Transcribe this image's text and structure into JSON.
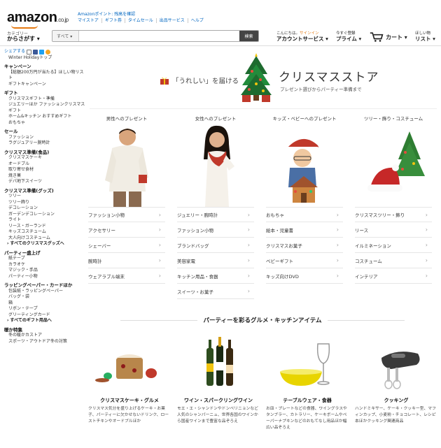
{
  "header": {
    "logo_text": "amazon",
    "logo_suffix": ".co.jp",
    "promo_link": "Amazonポイント: 残高を確認",
    "top_links": [
      "マイストア",
      "ギフト券",
      "タイムセール",
      "出品サービス",
      "ヘルプ"
    ],
    "category_small": "カテゴリー",
    "category_label": "からさがす ▾",
    "search_category": "すべて ▾",
    "search_placeholder": "",
    "search_button": "検索",
    "greeting_pre": "こんにちは。",
    "greeting_signin": "サインイン",
    "account_label": "アカウントサービス ▾",
    "prime_small": "今すぐ登録",
    "prime_label": "プライム ▾",
    "cart_label": "カート ▾",
    "wishlist_small": "ほしい物",
    "wishlist_label": "リスト ▾"
  },
  "sidebar": {
    "share_label": "シェアする",
    "holiday_link": "Winter Holidayトップ",
    "sections": [
      {
        "heading": "キャンペーン",
        "items": [
          "【総額200万円が当たる】ほしい物リスト",
          "ギフトキャンペーン"
        ]
      },
      {
        "heading": "ギフト",
        "items": [
          "クリスマスギフト・準備",
          "ジュエリーほか ファッションクリスマスギフト",
          "ホーム&キッチン おすすめギフト",
          "おもちゃ"
        ]
      },
      {
        "heading": "セール",
        "items": [
          "ファッション",
          "ラグジュアリー腕時計"
        ]
      },
      {
        "heading": "クリスマス準備(食品)",
        "items": [
          "クリスマスケーキ",
          "オードブル",
          "取り寄せ食材",
          "焼き菓",
          "デパ地下スイーツ"
        ]
      },
      {
        "heading": "クリスマス準備(グッズ)",
        "items": [
          "ツリー",
          "ツリー飾り",
          "デコレーション",
          "ガーデンデコレーション",
          "ライト",
          "リース・ガーランド",
          "キッズコスチューム",
          "大人向けコスチューム"
        ],
        "all": "› すべてのクリスマスグッズへ"
      },
      {
        "heading": "パーティー盛上げ",
        "items": [
          "紙テープ",
          "カラオケ",
          "マジック・手品",
          "パーティー小物"
        ]
      },
      {
        "heading": "ラッピングペーパー・カードほか",
        "items": [
          "包装紙・ラッピングペーパー",
          "バッグ・袋",
          "箱",
          "リボン・テープ",
          "グリーティングカード"
        ],
        "all": "› すべてのギフト用品へ"
      },
      {
        "heading": "暖か特集",
        "items": [
          "冬の暖かカストア",
          "スポーツ・アウトドア冬の対策"
        ]
      }
    ]
  },
  "banner": {
    "tagline": "「うれしい」を届ける",
    "title": "クリスマスストア",
    "subtitle": "プレゼント選びからパーティー準備まで"
  },
  "columns": [
    {
      "title": "男性へのプレゼント",
      "items": [
        "ファッション小物",
        "アクセサリー",
        "シェーバー",
        "腕時計",
        "ウェアラブル端末"
      ]
    },
    {
      "title": "女性へのプレゼント",
      "items": [
        "ジュエリー・腕時計",
        "ファッション小物",
        "ブランドバッグ",
        "美容家電",
        "キッチン用品・食器",
        "スイーツ・お菓子"
      ]
    },
    {
      "title": "キッズ・ベビーへのプレゼント",
      "items": [
        "おもちゃ",
        "絵本・児童書",
        "クリスマスお菓子",
        "ベビーギフト",
        "キッズ向けDVD"
      ]
    },
    {
      "title": "ツリー・飾り・コスチューム",
      "items": [
        "クリスマスツリー・飾り",
        "リース",
        "イルミネーション",
        "コスチューム",
        "インテリア"
      ]
    }
  ],
  "gourmet": {
    "title": "パーティーを彩るグルメ・キッチンアイテム",
    "products": [
      {
        "name": "クリスマスケーキ・グルメ",
        "desc": "クリスマス気分を盛り上げるケーキ・お菓子、パーティーに欠かせないドリンク、ローストチキンやオードブルほか"
      },
      {
        "name": "ワイン・スパークリングワイン",
        "desc": "モエ・エ・シャンドンやドンペリニョンなど人気のシャンパーニュ、世界各国のワインから国産ワインまで豊富な品ぞろえ"
      },
      {
        "name": "テーブルウェア・食器",
        "desc": "お皿・プレートなどの食器、ワイングラスやタンブラー、カトラリー、ケーキボームやペーパーナプキンなどのおもてなし用品ほか幅広い品ぞろえ"
      },
      {
        "name": "クッキング",
        "desc": "ハンドミキサー、ケーキ・クッキー型、マフィンカップ、小麦粉・チョコレート、レシピ本ほかクッキング関連商品"
      }
    ]
  },
  "colors": {
    "accent": "#e47911",
    "link": "#0066c0",
    "search_button": "#444444"
  }
}
